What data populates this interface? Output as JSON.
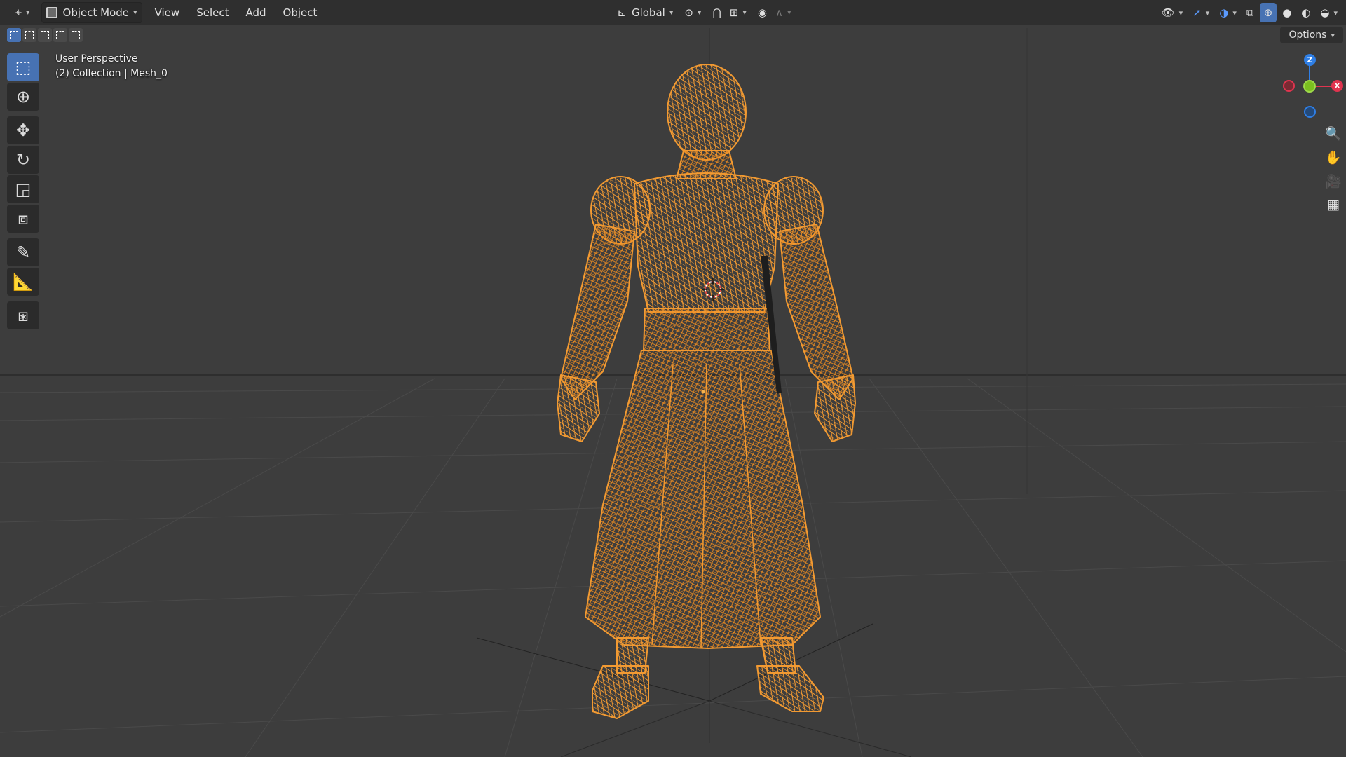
{
  "header": {
    "editor_type_icon": "viewport-editor-icon",
    "mode_label": "Object Mode",
    "menus": [
      "View",
      "Select",
      "Add",
      "Object"
    ],
    "transform_orientation": "Global",
    "right_icons": [
      "visibility-icon",
      "gizmo-icon",
      "overlays-icon",
      "xray-icon",
      "wireframe-shading-icon",
      "solid-shading-icon",
      "material-shading-icon",
      "rendered-shading-icon"
    ]
  },
  "options_label": "Options",
  "viewport": {
    "view_name": "User Perspective",
    "collection_info": "(2) Collection | Mesh_0"
  },
  "toolbar": {
    "tools": [
      "select-box-icon",
      "cursor-icon",
      "move-icon",
      "rotate-icon",
      "scale-icon",
      "transform-icon",
      "annotate-icon",
      "measure-icon",
      "add-cube-icon"
    ],
    "active_index": 0
  },
  "gizmo": {
    "z": "Z",
    "x": "X",
    "y": "Y"
  },
  "colors": {
    "wireframe_selected": "#f2962a",
    "background": "#3d3d3d",
    "active_tool": "#4772b3",
    "axis_x": "#e0344f",
    "axis_y": "#7bbf1f",
    "axis_z": "#2f7fe6"
  }
}
